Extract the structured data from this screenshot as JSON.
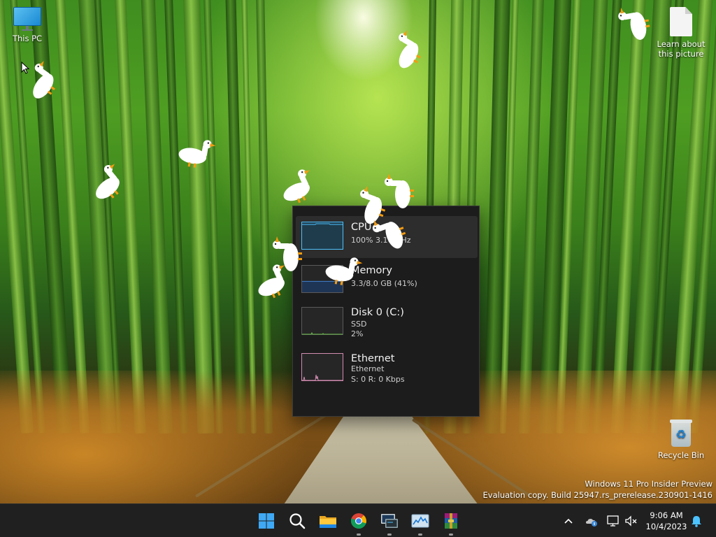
{
  "desktop": {
    "icons": [
      {
        "label": "This PC",
        "icon": "computer-icon"
      },
      {
        "label": "Learn about this picture",
        "icon": "file-icon"
      },
      {
        "label": "Recycle Bin",
        "icon": "recycle-bin-icon"
      }
    ],
    "watermark": {
      "line1": "Windows 11 Pro Insider Preview",
      "line2": "Evaluation copy. Build 25947.rs_prerelease.230901-1416"
    }
  },
  "perf_widget": {
    "rows": [
      {
        "title": "CPU",
        "line1": "100%  3.10 GHz",
        "line2": "",
        "color": "#4cc2ff",
        "selected": true
      },
      {
        "title": "Memory",
        "line1": "3.3/8.0 GB (41%)",
        "line2": "",
        "color": "#3f7fd0",
        "selected": false,
        "fill": 0.41
      },
      {
        "title": "Disk 0 (C:)",
        "line1": "SSD",
        "line2": "2%",
        "color": "#6abf4b",
        "selected": false
      },
      {
        "title": "Ethernet",
        "line1": "Ethernet",
        "line2": "S: 0  R: 0 Kbps",
        "color": "#d28bb0",
        "selected": false
      }
    ]
  },
  "taskbar": {
    "apps": [
      {
        "name": "start-button",
        "icon": "windows-logo-icon"
      },
      {
        "name": "search-button",
        "icon": "search-icon"
      },
      {
        "name": "file-explorer",
        "icon": "folder-icon"
      },
      {
        "name": "chrome",
        "icon": "chrome-icon"
      },
      {
        "name": "remote-app",
        "icon": "terminal-icon"
      },
      {
        "name": "task-manager",
        "icon": "performance-icon"
      },
      {
        "name": "winrar",
        "icon": "archive-icon"
      }
    ],
    "clock": {
      "time": "9:06 AM",
      "date": "10/4/2023"
    }
  },
  "colors": {
    "taskbar": "#202020",
    "widget_bg": "#1c1c1c",
    "accent": "#4cc2ff"
  }
}
